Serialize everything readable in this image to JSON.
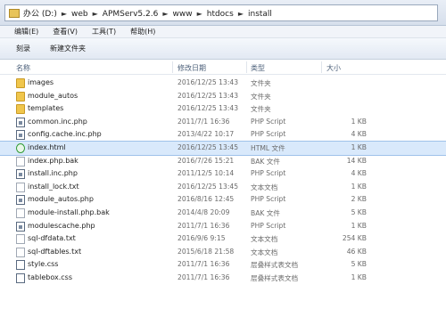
{
  "address": {
    "segments": [
      "办公 (D:)",
      "web",
      "APMServ5.2.6",
      "www",
      "htdocs",
      "install"
    ]
  },
  "menu": [
    "编辑(E)",
    "查看(V)",
    "工具(T)",
    "帮助(H)"
  ],
  "toolbar": [
    "刻录",
    "新建文件夹"
  ],
  "columns": {
    "name": "名称",
    "date": "修改日期",
    "type": "类型",
    "size": "大小"
  },
  "files": [
    {
      "name": "images",
      "date": "2016/12/25 13:43",
      "type": "文件夹",
      "size": "",
      "icon": "folder-icon"
    },
    {
      "name": "module_autos",
      "date": "2016/12/25 13:43",
      "type": "文件夹",
      "size": "",
      "icon": "folder-icon"
    },
    {
      "name": "templates",
      "date": "2016/12/25 13:43",
      "type": "文件夹",
      "size": "",
      "icon": "folder-icon"
    },
    {
      "name": "common.inc.php",
      "date": "2011/7/1 16:36",
      "type": "PHP Script",
      "size": "1 KB",
      "icon": "php-file-icon"
    },
    {
      "name": "config.cache.inc.php",
      "date": "2013/4/22 10:17",
      "type": "PHP Script",
      "size": "4 KB",
      "icon": "php-file-icon"
    },
    {
      "name": "index.html",
      "date": "2016/12/25 13:45",
      "type": "HTML 文件",
      "size": "1 KB",
      "icon": "html-file-icon",
      "selected": true
    },
    {
      "name": "index.php.bak",
      "date": "2016/7/26 15:21",
      "type": "BAK 文件",
      "size": "14 KB",
      "icon": "file-icon"
    },
    {
      "name": "install.inc.php",
      "date": "2011/12/5 10:14",
      "type": "PHP Script",
      "size": "4 KB",
      "icon": "php-file-icon"
    },
    {
      "name": "install_lock.txt",
      "date": "2016/12/25 13:45",
      "type": "文本文档",
      "size": "1 KB",
      "icon": "text-file-icon"
    },
    {
      "name": "module_autos.php",
      "date": "2016/8/16 12:45",
      "type": "PHP Script",
      "size": "2 KB",
      "icon": "php-file-icon"
    },
    {
      "name": "module-install.php.bak",
      "date": "2014/4/8 20:09",
      "type": "BAK 文件",
      "size": "5 KB",
      "icon": "file-icon"
    },
    {
      "name": "modulescache.php",
      "date": "2011/7/1 16:36",
      "type": "PHP Script",
      "size": "1 KB",
      "icon": "php-file-icon"
    },
    {
      "name": "sql-dfdata.txt",
      "date": "2016/9/6 9:15",
      "type": "文本文档",
      "size": "254 KB",
      "icon": "text-file-icon"
    },
    {
      "name": "sql-dftables.txt",
      "date": "2015/6/18 21:58",
      "type": "文本文档",
      "size": "46 KB",
      "icon": "text-file-icon"
    },
    {
      "name": "style.css",
      "date": "2011/7/1 16:36",
      "type": "层叠样式表文档",
      "size": "5 KB",
      "icon": "css-file-icon"
    },
    {
      "name": "tablebox.css",
      "date": "2011/7/1 16:36",
      "type": "层叠样式表文档",
      "size": "1 KB",
      "icon": "css-file-icon"
    }
  ]
}
